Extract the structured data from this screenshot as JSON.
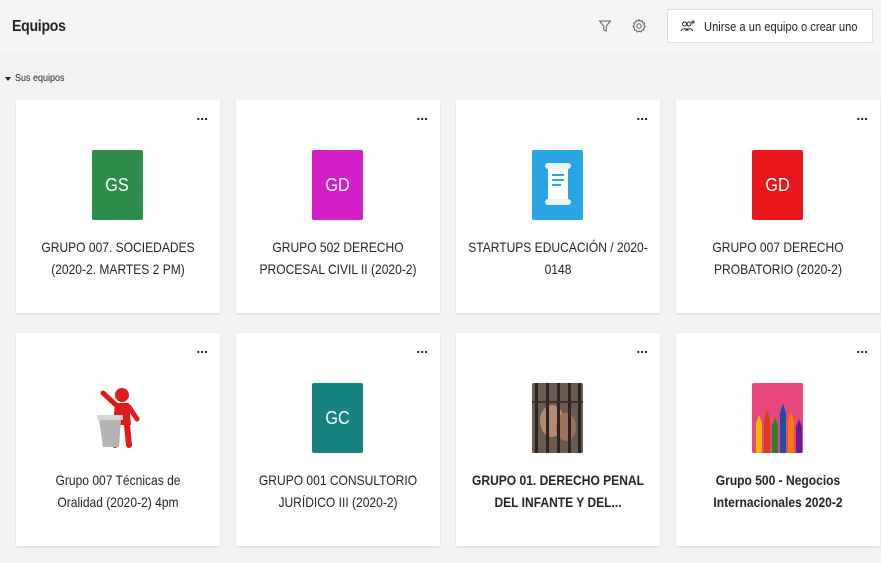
{
  "header": {
    "title": "Equipos",
    "join_label": "Unirse a un equipo o crear uno",
    "filter_icon": "filter-icon",
    "settings_icon": "gear-icon",
    "join_icon": "people-add-icon"
  },
  "section": {
    "label": "Sus equipos"
  },
  "more_label": "...",
  "teams": [
    {
      "name_line1": "GRUPO 007. SOCIEDADES",
      "name_line2": "(2020-2. MARTES 2 PM)",
      "initials": "GS",
      "color": "#2e8b4a",
      "bold": false,
      "avatar_type": "initials"
    },
    {
      "name_line1": "GRUPO 502 DERECHO",
      "name_line2": "PROCESAL CIVIL II (2020-2)",
      "initials": "GD",
      "color": "#d41ec7",
      "bold": false,
      "avatar_type": "initials"
    },
    {
      "name_line1": "STARTUPS EDUCACIÓN / 2020-",
      "name_line2": "0148",
      "initials": "",
      "color": "#2aa5e6",
      "bold": false,
      "avatar_type": "scroll-icon"
    },
    {
      "name_line1": "GRUPO 007 DERECHO",
      "name_line2": "PROBATORIO (2020-2)",
      "initials": "GD",
      "color": "#e8171c",
      "bold": false,
      "avatar_type": "initials"
    },
    {
      "name_line1": "Grupo 007 Técnicas de",
      "name_line2": "Oralidad (2020-2) 4pm",
      "initials": "",
      "color": "#ffffff",
      "bold": false,
      "avatar_type": "speaker-image"
    },
    {
      "name_line1": "GRUPO 001 CONSULTORIO",
      "name_line2": "JURÍDICO III (2020-2)",
      "initials": "GC",
      "color": "#16837e",
      "bold": false,
      "avatar_type": "initials"
    },
    {
      "name_line1": "GRUPO 01. DERECHO PENAL",
      "name_line2": "DEL INFANTE Y DEL...",
      "initials": "",
      "color": "#5a4a42",
      "bold": true,
      "avatar_type": "prison-image"
    },
    {
      "name_line1": "Grupo 500 - Negocios",
      "name_line2": "Internacionales 2020-2",
      "initials": "",
      "color": "#e8477e",
      "bold": true,
      "avatar_type": "pencils-image"
    }
  ]
}
